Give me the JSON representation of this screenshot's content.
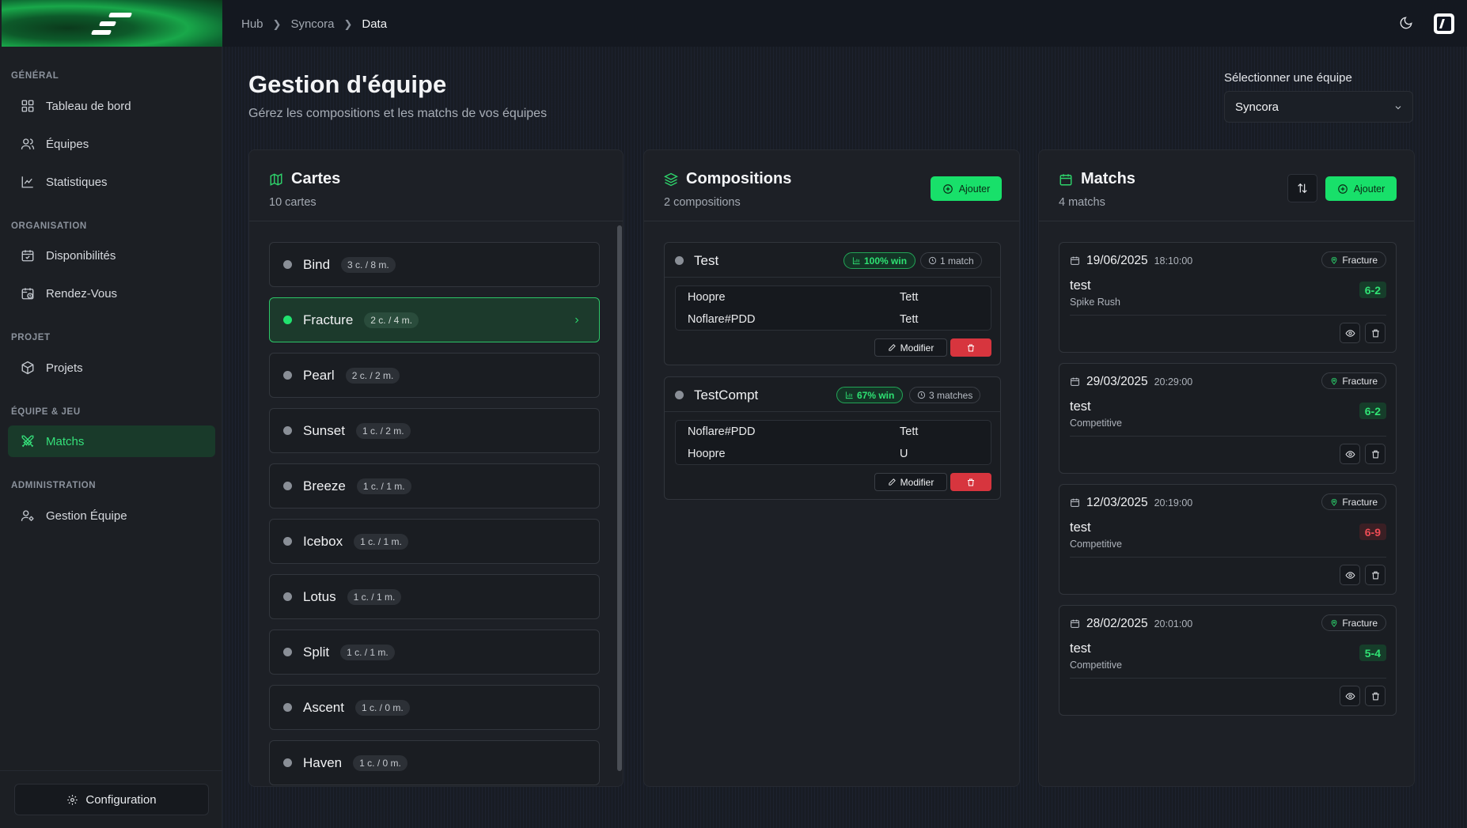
{
  "breadcrumb": [
    "Hub",
    "Syncora",
    "Data"
  ],
  "sidebar": {
    "sections": [
      {
        "title": "GÉNÉRAL",
        "items": [
          {
            "label": "Tableau de bord"
          },
          {
            "label": "Équipes"
          },
          {
            "label": "Statistiques"
          }
        ]
      },
      {
        "title": "ORGANISATION",
        "items": [
          {
            "label": "Disponibilités"
          },
          {
            "label": "Rendez-Vous"
          }
        ]
      },
      {
        "title": "PROJET",
        "items": [
          {
            "label": "Projets"
          }
        ]
      },
      {
        "title": "ÉQUIPE & JEU",
        "items": [
          {
            "label": "Matchs",
            "active": true
          }
        ]
      },
      {
        "title": "ADMINISTRATION",
        "items": [
          {
            "label": "Gestion Équipe"
          }
        ]
      }
    ],
    "config_label": "Configuration"
  },
  "header": {
    "title": "Gestion d'équipe",
    "subtitle": "Gérez les compositions et les matchs de vos équipes",
    "team_select_label": "Sélectionner une équipe",
    "team_select_value": "Syncora"
  },
  "maps_panel": {
    "title": "Cartes",
    "count": "10 cartes",
    "maps": [
      {
        "name": "Bind",
        "badge": "3 c. / 8 m."
      },
      {
        "name": "Fracture",
        "badge": "2 c. / 4 m.",
        "active": true
      },
      {
        "name": "Pearl",
        "badge": "2 c. / 2 m."
      },
      {
        "name": "Sunset",
        "badge": "1 c. / 2 m."
      },
      {
        "name": "Breeze",
        "badge": "1 c. / 1 m."
      },
      {
        "name": "Icebox",
        "badge": "1 c. / 1 m."
      },
      {
        "name": "Lotus",
        "badge": "1 c. / 1 m."
      },
      {
        "name": "Split",
        "badge": "1 c. / 1 m."
      },
      {
        "name": "Ascent",
        "badge": "1 c. / 0 m."
      },
      {
        "name": "Haven",
        "badge": "1 c. / 0 m."
      }
    ]
  },
  "compositions_panel": {
    "title": "Compositions",
    "count": "2 compositions",
    "add_label": "Ajouter",
    "edit_label": "Modifier",
    "compositions": [
      {
        "name": "Test",
        "win": "100% win",
        "matches": "1 match",
        "players": [
          {
            "name": "Hoopre",
            "role": "Tett"
          },
          {
            "name": "Noflare#PDD",
            "role": "Tett"
          }
        ]
      },
      {
        "name": "TestCompt",
        "win": "67% win",
        "matches": "3 matches",
        "players": [
          {
            "name": "Noflare#PDD",
            "role": "Tett"
          },
          {
            "name": "Hoopre",
            "role": "U"
          }
        ]
      }
    ]
  },
  "matches_panel": {
    "title": "Matchs",
    "count": "4 matchs",
    "add_label": "Ajouter",
    "matches": [
      {
        "date": "19/06/2025",
        "time": "18:10:00",
        "map": "Fracture",
        "name": "test",
        "mode": "Spike Rush",
        "score": "6-2",
        "result": "win"
      },
      {
        "date": "29/03/2025",
        "time": "20:29:00",
        "map": "Fracture",
        "name": "test",
        "mode": "Competitive",
        "score": "6-2",
        "result": "win"
      },
      {
        "date": "12/03/2025",
        "time": "20:19:00",
        "map": "Fracture",
        "name": "test",
        "mode": "Competitive",
        "score": "6-9",
        "result": "loss"
      },
      {
        "date": "28/02/2025",
        "time": "20:01:00",
        "map": "Fracture",
        "name": "test",
        "mode": "Competitive",
        "score": "5-4",
        "result": "win"
      }
    ]
  },
  "colors": {
    "accent": "#18e06a",
    "danger": "#d7353e",
    "background": "#181c24"
  }
}
